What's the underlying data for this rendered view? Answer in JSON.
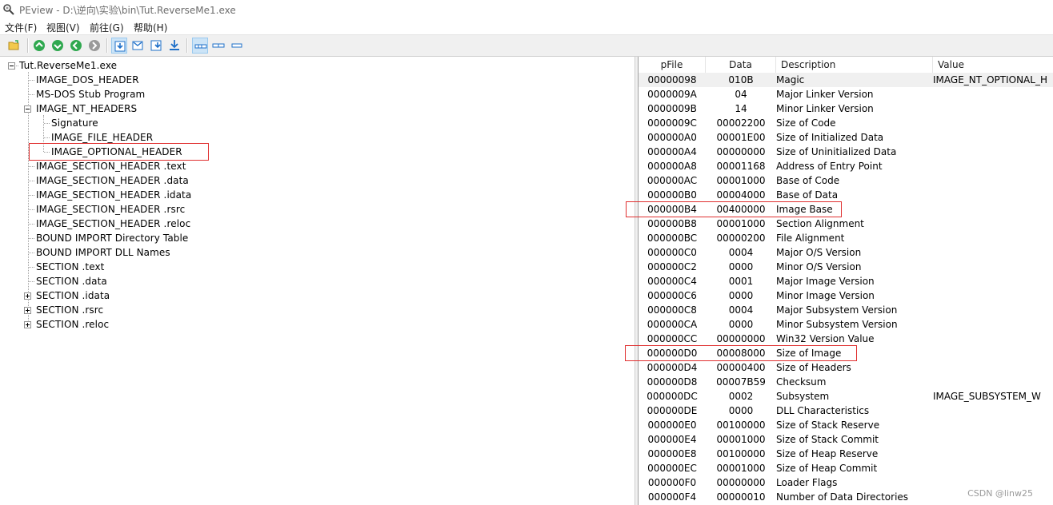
{
  "window": {
    "title": "PEview - D:\\逆向\\实验\\bin\\Tut.ReverseMe1.exe",
    "icon": "magnifier-app-icon"
  },
  "menu": [
    "文件(F)",
    "视图(V)",
    "前往(G)",
    "帮助(H)"
  ],
  "toolbar": {
    "icons": [
      "open-file-icon",
      "up-icon",
      "forward-icon",
      "back-icon",
      "disabled-nav-icon",
      "view-byte-icon",
      "view-word-icon",
      "view-dword-icon",
      "view-qword-icon",
      "layout-detail-icon",
      "layout-list-icon",
      "layout-small-icon"
    ]
  },
  "tree": [
    {
      "label": "Tut.ReverseMe1.exe",
      "level": 0,
      "expander": "minus"
    },
    {
      "label": "IMAGE_DOS_HEADER",
      "level": 1
    },
    {
      "label": "MS-DOS Stub Program",
      "level": 1
    },
    {
      "label": "IMAGE_NT_HEADERS",
      "level": 1,
      "expander": "minus"
    },
    {
      "label": "Signature",
      "level": 2
    },
    {
      "label": "IMAGE_FILE_HEADER",
      "level": 2
    },
    {
      "label": "IMAGE_OPTIONAL_HEADER",
      "level": 2,
      "highlighted": true
    },
    {
      "label": "IMAGE_SECTION_HEADER .text",
      "level": 1
    },
    {
      "label": "IMAGE_SECTION_HEADER .data",
      "level": 1
    },
    {
      "label": "IMAGE_SECTION_HEADER .idata",
      "level": 1
    },
    {
      "label": "IMAGE_SECTION_HEADER .rsrc",
      "level": 1
    },
    {
      "label": "IMAGE_SECTION_HEADER .reloc",
      "level": 1
    },
    {
      "label": "BOUND IMPORT Directory Table",
      "level": 1
    },
    {
      "label": "BOUND IMPORT DLL Names",
      "level": 1
    },
    {
      "label": "SECTION .text",
      "level": 1
    },
    {
      "label": "SECTION .data",
      "level": 1
    },
    {
      "label": "SECTION .idata",
      "level": 1,
      "expander": "plus"
    },
    {
      "label": "SECTION .rsrc",
      "level": 1,
      "expander": "plus"
    },
    {
      "label": "SECTION .reloc",
      "level": 1,
      "expander": "plus"
    }
  ],
  "list": {
    "columns": [
      "pFile",
      "Data",
      "Description",
      "Value"
    ],
    "rows": [
      {
        "pfile": "00000098",
        "data": "010B",
        "desc": "Magic",
        "value": "IMAGE_NT_OPTIONAL_H",
        "selected": true
      },
      {
        "pfile": "0000009A",
        "data": "04",
        "desc": "Major Linker Version",
        "value": ""
      },
      {
        "pfile": "0000009B",
        "data": "14",
        "desc": "Minor Linker Version",
        "value": ""
      },
      {
        "pfile": "0000009C",
        "data": "00002200",
        "desc": "Size of Code",
        "value": ""
      },
      {
        "pfile": "000000A0",
        "data": "00001E00",
        "desc": "Size of Initialized Data",
        "value": ""
      },
      {
        "pfile": "000000A4",
        "data": "00000000",
        "desc": "Size of Uninitialized Data",
        "value": ""
      },
      {
        "pfile": "000000A8",
        "data": "00001168",
        "desc": "Address of Entry Point",
        "value": ""
      },
      {
        "pfile": "000000AC",
        "data": "00001000",
        "desc": "Base of Code",
        "value": ""
      },
      {
        "pfile": "000000B0",
        "data": "00004000",
        "desc": "Base of Data",
        "value": ""
      },
      {
        "pfile": "000000B4",
        "data": "00400000",
        "desc": "Image Base",
        "value": "",
        "highlighted": true
      },
      {
        "pfile": "000000B8",
        "data": "00001000",
        "desc": "Section Alignment",
        "value": ""
      },
      {
        "pfile": "000000BC",
        "data": "00000200",
        "desc": "File Alignment",
        "value": ""
      },
      {
        "pfile": "000000C0",
        "data": "0004",
        "desc": "Major O/S Version",
        "value": ""
      },
      {
        "pfile": "000000C2",
        "data": "0000",
        "desc": "Minor O/S Version",
        "value": ""
      },
      {
        "pfile": "000000C4",
        "data": "0001",
        "desc": "Major Image Version",
        "value": ""
      },
      {
        "pfile": "000000C6",
        "data": "0000",
        "desc": "Minor Image Version",
        "value": ""
      },
      {
        "pfile": "000000C8",
        "data": "0004",
        "desc": "Major Subsystem Version",
        "value": ""
      },
      {
        "pfile": "000000CA",
        "data": "0000",
        "desc": "Minor Subsystem Version",
        "value": ""
      },
      {
        "pfile": "000000CC",
        "data": "00000000",
        "desc": "Win32 Version Value",
        "value": ""
      },
      {
        "pfile": "000000D0",
        "data": "00008000",
        "desc": "Size of Image",
        "value": "",
        "highlighted": true
      },
      {
        "pfile": "000000D4",
        "data": "00000400",
        "desc": "Size of Headers",
        "value": ""
      },
      {
        "pfile": "000000D8",
        "data": "00007B59",
        "desc": "Checksum",
        "value": ""
      },
      {
        "pfile": "000000DC",
        "data": "0002",
        "desc": "Subsystem",
        "value": "IMAGE_SUBSYSTEM_W"
      },
      {
        "pfile": "000000DE",
        "data": "0000",
        "desc": "DLL Characteristics",
        "value": ""
      },
      {
        "pfile": "000000E0",
        "data": "00100000",
        "desc": "Size of Stack Reserve",
        "value": ""
      },
      {
        "pfile": "000000E4",
        "data": "00001000",
        "desc": "Size of Stack Commit",
        "value": ""
      },
      {
        "pfile": "000000E8",
        "data": "00100000",
        "desc": "Size of Heap Reserve",
        "value": ""
      },
      {
        "pfile": "000000EC",
        "data": "00001000",
        "desc": "Size of Heap Commit",
        "value": ""
      },
      {
        "pfile": "000000F0",
        "data": "00000000",
        "desc": "Loader Flags",
        "value": ""
      },
      {
        "pfile": "000000F4",
        "data": "00000010",
        "desc": "Number of Data Directories",
        "value": ""
      }
    ]
  },
  "watermark": "CSDN @linw25",
  "colors": {
    "highlight": "#e03030",
    "accent_blue": "#1e6fc8",
    "nav_green": "#2fa84f"
  }
}
